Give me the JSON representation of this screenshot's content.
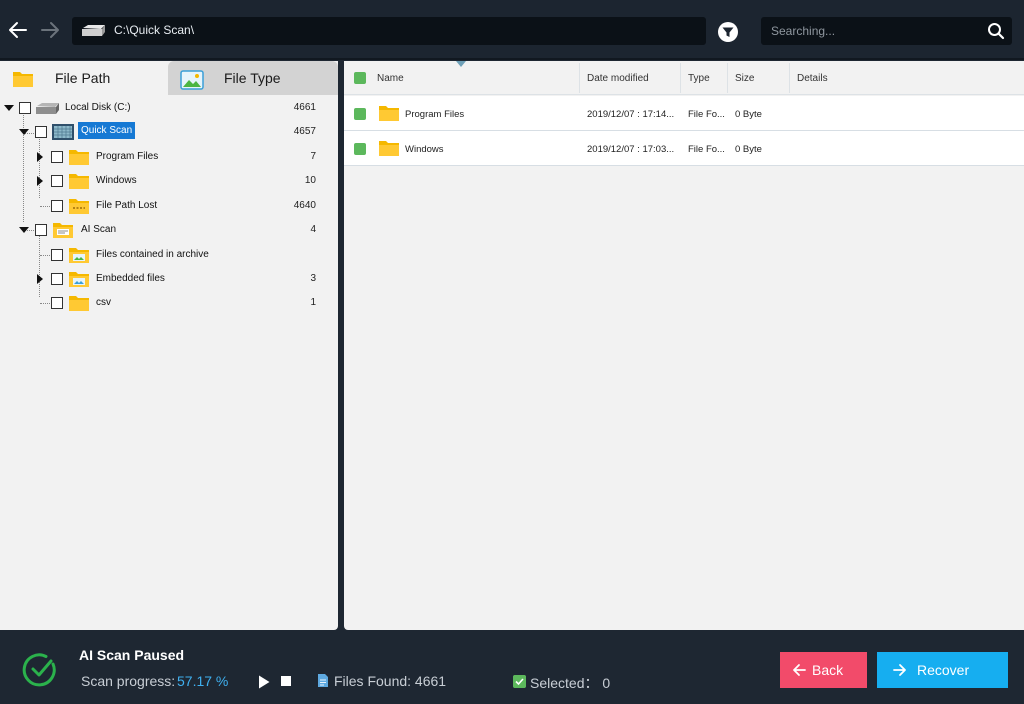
{
  "toolbar": {
    "path": "C:\\Quick Scan\\",
    "search_placeholder": "Searching..."
  },
  "tabs": [
    {
      "label": "File Path",
      "active": true
    },
    {
      "label": "File Type",
      "active": false
    }
  ],
  "tree": [
    {
      "label": "Local Disk (C:)",
      "count": "4661",
      "icon": "drive-icon"
    },
    {
      "label": "Quick Scan",
      "count": "4657",
      "icon": "scan-chip-icon",
      "selected": true
    },
    {
      "label": "Program Files",
      "count": "7",
      "icon": "folder-icon"
    },
    {
      "label": "Windows",
      "count": "10",
      "icon": "folder-icon"
    },
    {
      "label": "File Path Lost",
      "count": "4640",
      "icon": "folder-lost-icon"
    },
    {
      "label": "AI Scan",
      "count": "4",
      "icon": "ai-scan-folder-icon"
    },
    {
      "label": "Files contained in archive",
      "count": "",
      "icon": "archive-folder-icon"
    },
    {
      "label": "Embedded files",
      "count": "3",
      "icon": "embedded-folder-icon"
    },
    {
      "label": "csv",
      "count": "1",
      "icon": "folder-icon"
    }
  ],
  "table": {
    "columns": [
      "Name",
      "Date modified",
      "Type",
      "Size",
      "Details"
    ],
    "rows": [
      {
        "name": "Program Files",
        "date": "2019/12/07 : 17:14...",
        "type": "File Fo...",
        "size": "0 Byte",
        "details": ""
      },
      {
        "name": "Windows",
        "date": "2019/12/07 : 17:03...",
        "type": "File Fo...",
        "size": "0 Byte",
        "details": ""
      }
    ]
  },
  "status": {
    "title": "AI Scan Paused",
    "progress_label": "Scan progress:",
    "progress_value": "57.17 %",
    "progress_fraction": 0.5717,
    "files_found": "Files Found: 4661",
    "selected": "Selected： 0"
  },
  "buttons": {
    "back": "Back",
    "recover": "Recover"
  },
  "colors": {
    "accent_blue": "#16aef0",
    "back_red": "#f24b6a",
    "check_green": "#5cb85c",
    "folder_yellow": "#f5b800",
    "selected_blue": "#1679d4"
  }
}
